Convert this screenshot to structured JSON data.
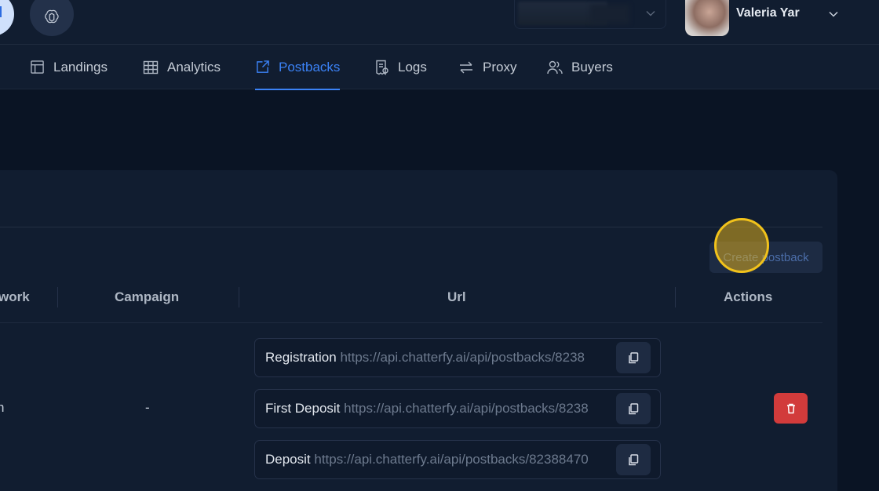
{
  "header": {
    "user_name": "Valeria Yar"
  },
  "nav": {
    "items": [
      {
        "label": "Landings",
        "icon": "layout-icon"
      },
      {
        "label": "Analytics",
        "icon": "table-icon"
      },
      {
        "label": "Postbacks",
        "icon": "external-link-icon",
        "active": true
      },
      {
        "label": "Logs",
        "icon": "receipt-icon"
      },
      {
        "label": "Proxy",
        "icon": "arrows-swap-icon"
      },
      {
        "label": "Buyers",
        "icon": "users-icon"
      }
    ]
  },
  "main": {
    "create_button_label": "Create postback",
    "columns": [
      "work",
      "Campaign",
      "Url",
      "Actions"
    ],
    "row": {
      "network_fragment": "n",
      "campaign": "-",
      "urls": [
        {
          "label": "Registration",
          "value": "https://api.chatterfy.ai/api/postbacks/8238"
        },
        {
          "label": "First Deposit",
          "value": "https://api.chatterfy.ai/api/postbacks/8238"
        },
        {
          "label": "Deposit",
          "value": "https://api.chatterfy.ai/api/postbacks/82388470"
        }
      ]
    }
  },
  "colors": {
    "accent": "#3b82f6",
    "danger": "#d23b3b",
    "background": "#0a1424",
    "surface": "#111d30"
  }
}
